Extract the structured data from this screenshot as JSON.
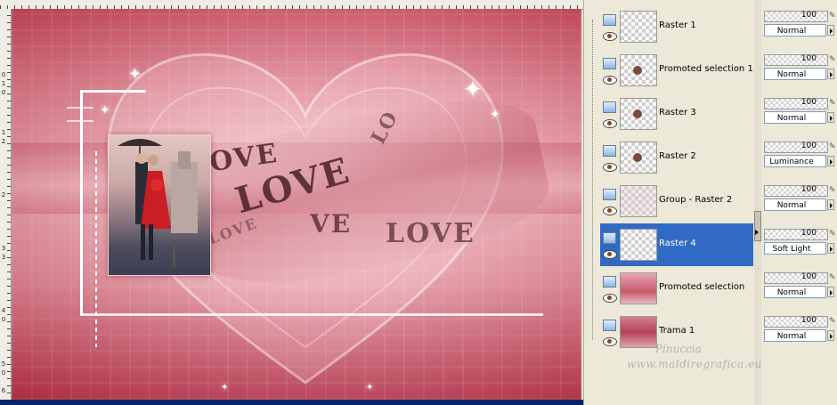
{
  "rulers": {
    "left_ticks": [
      "0",
      "1",
      "0",
      "1",
      "2",
      "2",
      "3",
      "3",
      "4",
      "0",
      "5",
      "0",
      "6"
    ]
  },
  "canvas": {
    "love_texts": [
      "OVE",
      "LOVE",
      "LO",
      "LOVE",
      "VE",
      "LOVE"
    ]
  },
  "layers": [
    {
      "name": "Raster 1",
      "selected": false,
      "thumb": "transparent"
    },
    {
      "name": "Promoted selection 1",
      "selected": false,
      "thumb": "object"
    },
    {
      "name": "Raster 3",
      "selected": false,
      "thumb": "object"
    },
    {
      "name": "Raster 2",
      "selected": false,
      "thumb": "object"
    },
    {
      "name": "Group - Raster 2",
      "selected": false,
      "thumb": "faint"
    },
    {
      "name": "Raster 4",
      "selected": true,
      "thumb": "transparent"
    },
    {
      "name": "Promoted selection",
      "selected": false,
      "thumb": "pink"
    },
    {
      "name": "Trama 1",
      "selected": false,
      "thumb": "pinkmix"
    }
  ],
  "properties": [
    {
      "opacity": "100",
      "blend": "Normal"
    },
    {
      "opacity": "100",
      "blend": "Normal"
    },
    {
      "opacity": "100",
      "blend": "Normal"
    },
    {
      "opacity": "100",
      "blend": "Luminance"
    },
    {
      "opacity": "100",
      "blend": "Normal"
    },
    {
      "opacity": "100",
      "blend": "Soft Light"
    },
    {
      "opacity": "100",
      "blend": "Normal"
    },
    {
      "opacity": "100",
      "blend": "Normal"
    }
  ],
  "watermark": {
    "line1": "Pinuccia",
    "line2": "www.maldiregrafica.eu"
  },
  "colors": {
    "selection": "#316ac5",
    "panel": "#ece9d8",
    "canvas_pink": "#c54a5e"
  }
}
